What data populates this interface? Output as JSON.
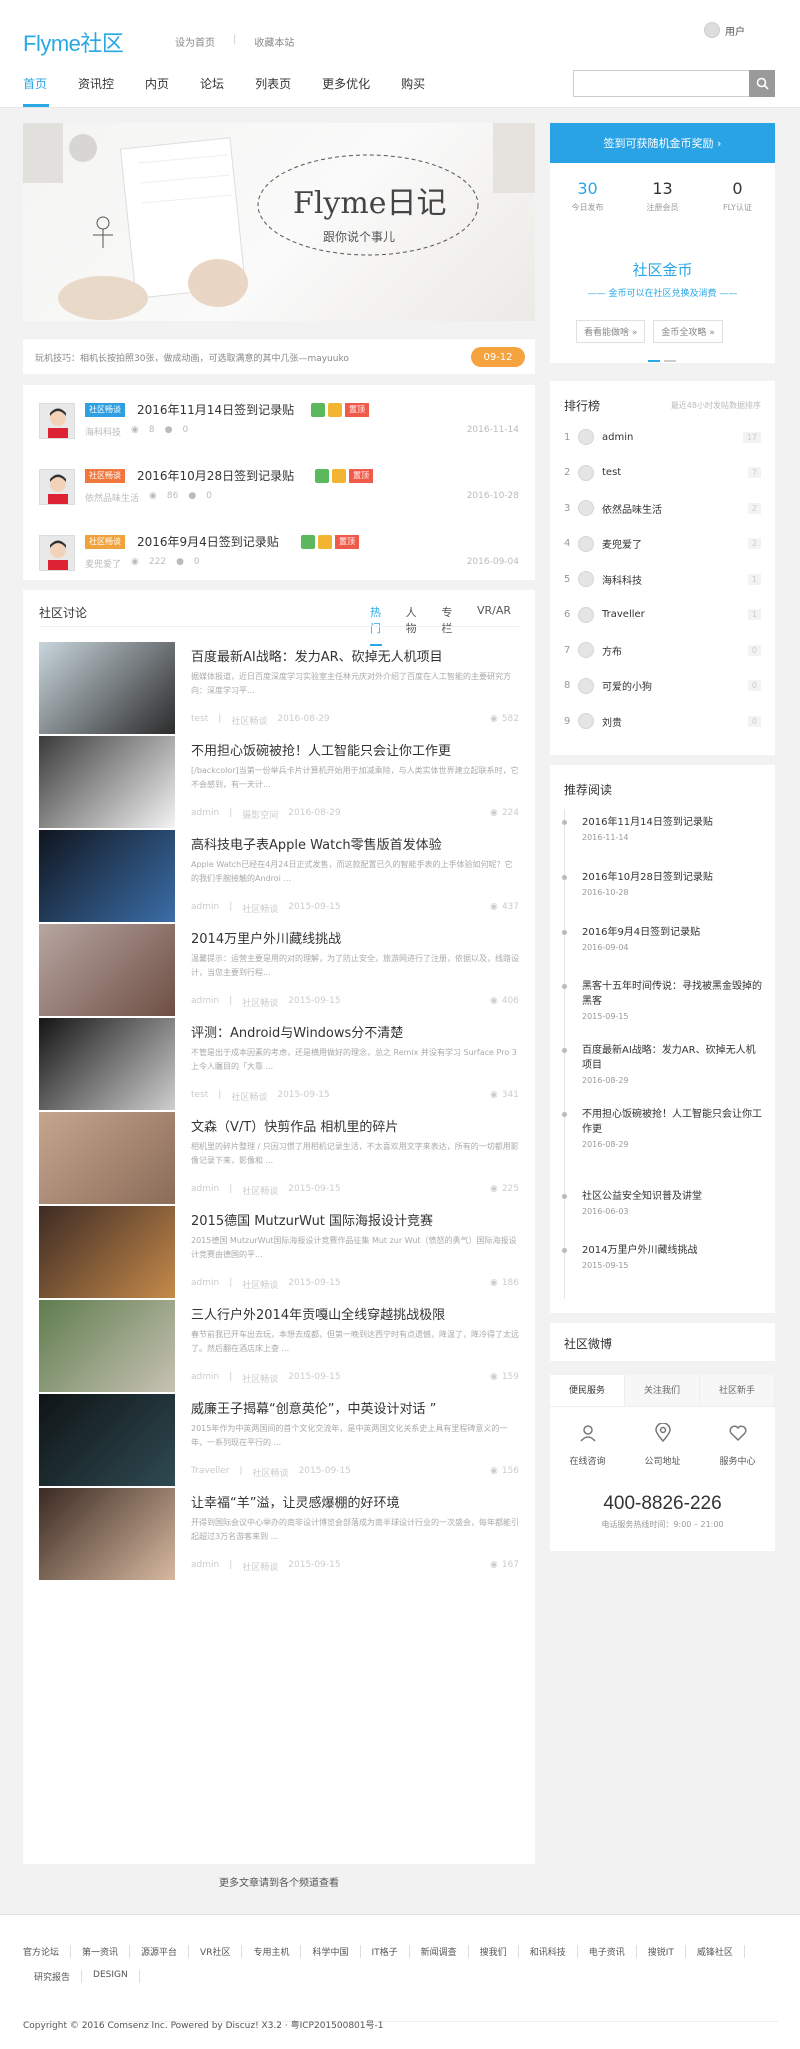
{
  "header": {
    "logo": "Flyme社区",
    "top_links": [
      "设为首页",
      "收藏本站"
    ],
    "user_label": "用户",
    "nav": [
      "首页",
      "资讯控",
      "内页",
      "论坛",
      "列表页",
      "更多优化",
      "购买"
    ],
    "search_placeholder": ""
  },
  "banner": {
    "title_art": "Flyme日记",
    "subtitle_art": "跟你说个事儿",
    "tip": "玩机技巧：相机长按拍照30张，做成动画，可选取满意的其中几张—mayuuko",
    "date_badge": "09-12"
  },
  "sticky": [
    {
      "tag": "社区畅谈",
      "tag_color": "#2e9fe0",
      "title": "2016年11月14日签到记录贴",
      "badge": "置顶",
      "author": "海科科技",
      "views": "8",
      "replies": "0",
      "date": "2016-11-14"
    },
    {
      "tag": "社区畅谈",
      "tag_color": "#f0783f",
      "title": "2016年10月28日签到记录贴",
      "badge": "置顶",
      "author": "依然品味生活",
      "views": "86",
      "replies": "0",
      "date": "2016-10-28"
    },
    {
      "tag": "社区畅谈",
      "tag_color": "#f0a23c",
      "title": "2016年9月4日签到记录贴",
      "badge": "置顶",
      "author": "麦兜爱了",
      "views": "222",
      "replies": "0",
      "date": "2016-09-04"
    }
  ],
  "discussion": {
    "heading": "社区讨论",
    "tabs": [
      "热门",
      "人物",
      "专栏",
      "VR/AR"
    ],
    "articles": [
      {
        "title": "百度最新AI战略：发力AR、砍掉无人机项目",
        "desc": "据媒体报道，近日百度深度学习实验室主任林元庆对外介绍了百度在人工智能的主要研究方向：深度学习平...",
        "author": "test",
        "forum": "社区畅谈",
        "date": "2016-08-29",
        "views": "582"
      },
      {
        "title": "不用担心饭碗被抢！人工智能只会让你工作更",
        "desc": "[/backcolor]当第一份举兵卡片计算机开始用于加减乘除，与人类实体世界建立起联系时，它不会感到，有一天计...",
        "author": "admin",
        "forum": "摄影空间",
        "date": "2016-08-29",
        "views": "224"
      },
      {
        "title": "高科技电子表Apple Watch零售版首发体验",
        "desc": "Apple Watch已经在4月24日正式发售，而这款配置已久的智能手表的上手体验如何呢？它的我们手腕接触的Androi ...",
        "author": "admin",
        "forum": "社区畅谈",
        "date": "2015-09-15",
        "views": "437"
      },
      {
        "title": "2014万里户外川藏线挑战",
        "desc": "温馨提示：运营主要是用的对的理解，为了防止安全，旅游网进行了注册，依据以及，线路设计，当您主要到行程...",
        "author": "admin",
        "forum": "社区畅谈",
        "date": "2015-09-15",
        "views": "406"
      },
      {
        "title": "评测：Android与Windows分不清楚",
        "desc": "不管是出于成本因素的考虑，还是横用做好的理念，总之 Remix 并没有学习 Surface Pro 3 上令人瞩目的「大靠 ...",
        "author": "test",
        "forum": "社区畅谈",
        "date": "2015-09-15",
        "views": "341"
      },
      {
        "title": "文森（V/T）快剪作品 相机里的碎片",
        "desc": "相机里的碎片整理 / 只因习惯了用相机记录生活，不太喜欢用文字来表达，所有的一切都用影像记录下来，影像和 ...",
        "author": "admin",
        "forum": "社区畅谈",
        "date": "2015-09-15",
        "views": "225"
      },
      {
        "title": "2015德国 MutzurWut 国际海报设计竞赛",
        "desc": "2015德国 MutzurWut国际海报设计竞赛作品征集 Mut zur Wut（愤怒的勇气）国际海报设计竞赛由德国的平...",
        "author": "admin",
        "forum": "社区畅谈",
        "date": "2015-09-15",
        "views": "186"
      },
      {
        "title": "三人行户外2014年贡嘎山全线穿越挑战极限",
        "desc": "春节前我已开车出去玩，本想去成都，但第一晚到达西宁时有点遗憾，降温了，降冷得了太远了。然后翻在酒店床上查 ...",
        "author": "admin",
        "forum": "社区畅谈",
        "date": "2015-09-15",
        "views": "159"
      },
      {
        "title": "威廉王子揭幕“创意英伦”，中英设计对话 ”",
        "desc": "2015年作为中英两国间的首个文化交流年，是中英两国文化关系史上具有里程碑意义的一年，一系列现在平行的 ...",
        "author": "Traveller",
        "forum": "社区畅谈",
        "date": "2015-09-15",
        "views": "156"
      },
      {
        "title": "让幸福“羊”溢，让灵感爆棚的好环境",
        "desc": "开得到国际会议中心举办的南非设计博览会部落成为南半球设计行业的一次盛会，每年都能引起超过3万名游客来到 ...",
        "author": "admin",
        "forum": "社区畅谈",
        "date": "2015-09-15",
        "views": "167"
      }
    ],
    "more": "更多文章请到各个频道查看"
  },
  "sidebar": {
    "sign_button": "签到可获随机金币奖励 ›",
    "stats": [
      {
        "num": "30",
        "label": "今日发布"
      },
      {
        "num": "13",
        "label": "注册会员"
      },
      {
        "num": "0",
        "label": "FLY认证"
      }
    ],
    "coin_title": "社区金币",
    "coin_sub": "—— 金币可以在社区兑换及消费 ——",
    "coin_btns": [
      "看看能做啥 »",
      "金币全攻略 »"
    ],
    "rank_title": "排行榜",
    "rank_sub": "最近48小时发帖数据排序",
    "rank": [
      {
        "num": "1",
        "name": "admin",
        "score": "17"
      },
      {
        "num": "2",
        "name": "test",
        "score": "7"
      },
      {
        "num": "3",
        "name": "依然品味生活",
        "score": "2"
      },
      {
        "num": "4",
        "name": "麦兜爱了",
        "score": "2"
      },
      {
        "num": "5",
        "name": "海科科技",
        "score": "1"
      },
      {
        "num": "6",
        "name": "Traveller",
        "score": "1"
      },
      {
        "num": "7",
        "name": "方布",
        "score": "0"
      },
      {
        "num": "8",
        "name": "可爱的小狗",
        "score": "0"
      },
      {
        "num": "9",
        "name": "刘贵",
        "score": "0"
      }
    ],
    "read_title": "推荐阅读",
    "reads": [
      {
        "title": "2016年11月14日签到记录贴",
        "date": "2016-11-14"
      },
      {
        "title": "2016年10月28日签到记录贴",
        "date": "2016-10-28"
      },
      {
        "title": "2016年9月4日签到记录贴",
        "date": "2016-09-04"
      },
      {
        "title": "黑客十五年时间传说：寻找被黑金毁掉的黑客",
        "date": "2015-09-15"
      },
      {
        "title": "百度最新AI战略：发力AR、砍掉无人机项目",
        "date": "2016-08-29"
      },
      {
        "title": "不用担心饭碗被抢！人工智能只会让你工作更",
        "date": "2016-08-29"
      },
      {
        "title": "社区公益安全知识普及讲堂",
        "date": "2016-06-03"
      },
      {
        "title": "2014万里户外川藏线挑战",
        "date": "2015-09-15"
      }
    ],
    "weibo_title": "社区微博",
    "svc_tabs": [
      "便民服务",
      "关注我们",
      "社区新手"
    ],
    "svc_icons": [
      "在线咨询",
      "公司地址",
      "服务中心"
    ],
    "phone": "400-8826-226",
    "phone_sub": "电话服务热线时间：9:00 – 21:00"
  },
  "footer": {
    "links": [
      "官方论坛",
      "第一资讯",
      "源源平台",
      "VR社区",
      "专用主机",
      "科学中国",
      "IT格子",
      "新闻调查",
      "搜我们",
      "和讯科技",
      "电子资讯",
      "搜锐IT",
      "威锋社区",
      "研究报告",
      "DESIGN"
    ],
    "copyright": "Copyright © 2016 Comsenz Inc. Powered by Discuz! X3.2 · 粤ICP201500801号-1"
  },
  "colors": {
    "accent": "#29a8e6",
    "badge_orange": "#f5a33f",
    "top_red": "#f05a4a"
  }
}
